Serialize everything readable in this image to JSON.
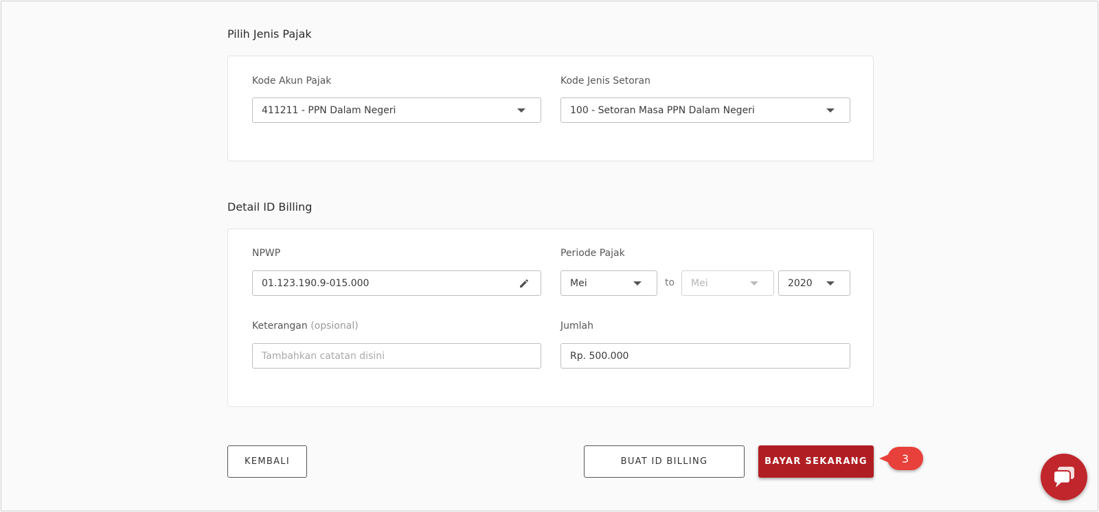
{
  "sections": {
    "tax_type_title": "Pilih Jenis Pajak",
    "billing_title": "Detail ID Billing"
  },
  "tax_type": {
    "account_code_label": "Kode Akun Pajak",
    "account_code_value": "411211 - PPN Dalam Negeri",
    "deposit_type_label": "Kode Jenis Setoran",
    "deposit_type_value": "100 - Setoran Masa PPN Dalam Negeri"
  },
  "billing": {
    "npwp_label": "NPWP",
    "npwp_value": "01.123.190.9-015.000",
    "period_label": "Periode Pajak",
    "period_from": "Mei",
    "period_to_text": "to",
    "period_to": "Mei",
    "period_year": "2020",
    "note_label": "Keterangan",
    "note_optional": "(opsional)",
    "note_placeholder": "Tambahkan catatan disini",
    "amount_label": "Jumlah",
    "amount_value": "Rp. 500.000"
  },
  "buttons": {
    "back": "KEMBALI",
    "create_billing": "BUAT ID BILLING",
    "pay_now": "BAYAR SEKARANG"
  },
  "callout": {
    "step": "3"
  },
  "colors": {
    "primary": "#b01e23",
    "callout": "#e8403a"
  },
  "icons": {
    "npwp_edit": "pencil-icon",
    "chat": "chat-bubble-icon"
  }
}
